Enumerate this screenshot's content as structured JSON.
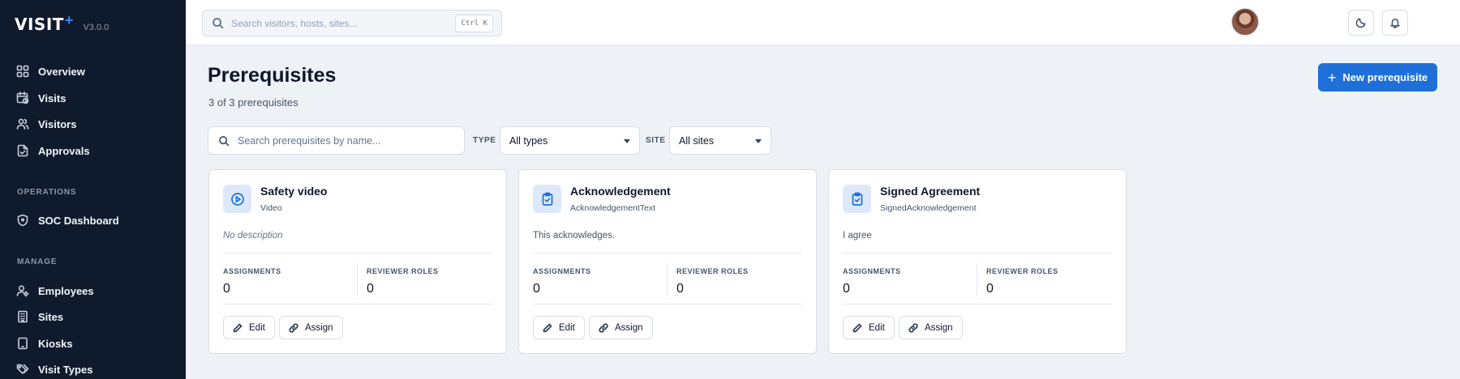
{
  "brand": {
    "name": "VISIT",
    "plus": "+",
    "version": "V3.0.0"
  },
  "sidebar": {
    "items": [
      {
        "label": "Overview",
        "icon": "grid-icon"
      },
      {
        "label": "Visits",
        "icon": "calendar-clock-icon"
      },
      {
        "label": "Visitors",
        "icon": "users-icon"
      },
      {
        "label": "Approvals",
        "icon": "file-check-icon"
      }
    ],
    "operations": {
      "title": "OPERATIONS",
      "items": [
        {
          "label": "SOC Dashboard",
          "icon": "shield-icon"
        }
      ]
    },
    "manage": {
      "title": "MANAGE",
      "items": [
        {
          "label": "Employees",
          "icon": "user-cog-icon"
        },
        {
          "label": "Sites",
          "icon": "building-icon"
        },
        {
          "label": "Kiosks",
          "icon": "tablet-icon"
        },
        {
          "label": "Visit Types",
          "icon": "tags-icon"
        }
      ]
    }
  },
  "topbar": {
    "search_placeholder": "Search visitors, hosts, sites...",
    "shortcut": "Ctrl K"
  },
  "page": {
    "title": "Prerequisites",
    "count_text": "3 of 3 prerequisites",
    "new_button": "New prerequisite"
  },
  "filters": {
    "search_placeholder": "Search prerequisites by name...",
    "type_label": "TYPE",
    "type_value": "All types",
    "site_label": "SITE",
    "site_value": "All sites"
  },
  "cards": [
    {
      "title": "Safety video",
      "type": "Video",
      "description": "No description",
      "assignments_label": "ASSIGNMENTS",
      "assignments": "0",
      "reviewer_label": "REVIEWER ROLES",
      "reviewer_roles": "0",
      "edit": "Edit",
      "assign": "Assign"
    },
    {
      "title": "Acknowledgement",
      "type": "AcknowledgementText",
      "description": "This acknowledges.",
      "assignments_label": "ASSIGNMENTS",
      "assignments": "0",
      "reviewer_label": "REVIEWER ROLES",
      "reviewer_roles": "0",
      "edit": "Edit",
      "assign": "Assign"
    },
    {
      "title": "Signed Agreement",
      "type": "SignedAcknowledgement",
      "description": "I agree",
      "assignments_label": "ASSIGNMENTS",
      "assignments": "0",
      "reviewer_label": "REVIEWER ROLES",
      "reviewer_roles": "0",
      "edit": "Edit",
      "assign": "Assign"
    }
  ],
  "colors": {
    "sidebar_bg": "#0f1b2d",
    "accent": "#1f6fd8",
    "page_bg": "#eef1f5"
  }
}
